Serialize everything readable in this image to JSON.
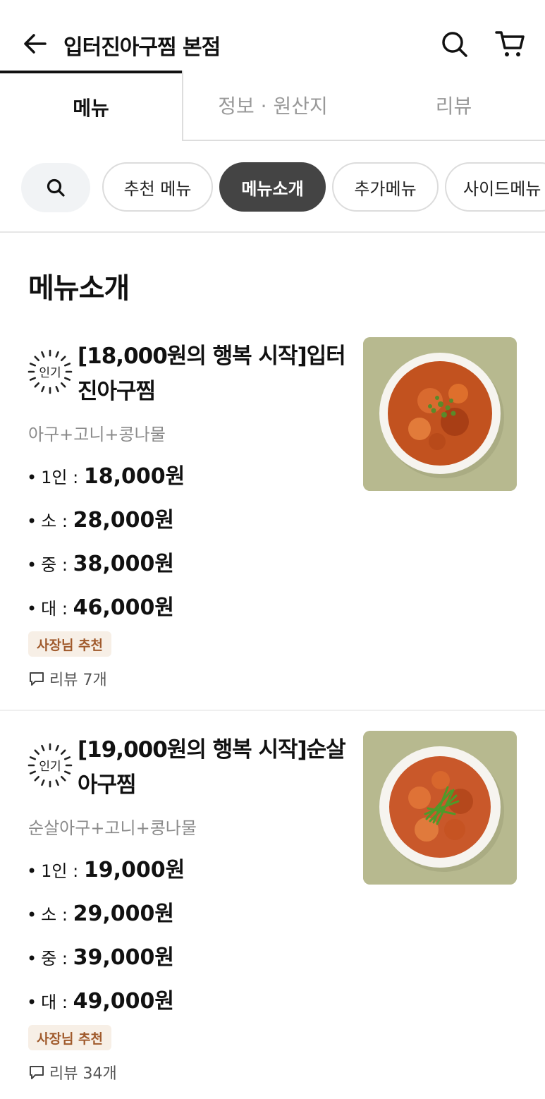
{
  "header": {
    "title": "입터진아구찜 본점"
  },
  "tabs": [
    {
      "label": "메뉴",
      "active": true
    },
    {
      "label": "정보 · 원산지",
      "active": false
    },
    {
      "label": "리뷰",
      "active": false
    }
  ],
  "chips": [
    {
      "label": "추천 메뉴",
      "active": false
    },
    {
      "label": "메뉴소개",
      "active": true
    },
    {
      "label": "추가메뉴",
      "active": false
    },
    {
      "label": "사이드메뉴",
      "active": false
    }
  ],
  "section": {
    "title": "메뉴소개"
  },
  "popular_badge": "인기",
  "menu_items": [
    {
      "name": "[18,000원의 행복 시작]입터진아구찜",
      "description": "아구+고니+콩나물",
      "prices": [
        {
          "label": "1인 :",
          "value": "18,000원"
        },
        {
          "label": "소 :",
          "value": "28,000원"
        },
        {
          "label": "중 :",
          "value": "38,000원"
        },
        {
          "label": "대 :",
          "value": "46,000원"
        }
      ],
      "tag": "사장님 추천",
      "reviews": "리뷰 7개"
    },
    {
      "name": "[19,000원의 행복 시작]순살아구찜",
      "description": "순살아구+고니+콩나물",
      "prices": [
        {
          "label": "1인 :",
          "value": "19,000원"
        },
        {
          "label": "소 :",
          "value": "29,000원"
        },
        {
          "label": "중 :",
          "value": "39,000원"
        },
        {
          "label": "대 :",
          "value": "49,000원"
        }
      ],
      "tag": "사장님 추천",
      "reviews": "리뷰 34개"
    }
  ],
  "colors": {
    "active_chip": "#444444",
    "tag_bg": "#f7efe6",
    "tag_text": "#a05a2c",
    "image_bg": "#b7b98f"
  }
}
